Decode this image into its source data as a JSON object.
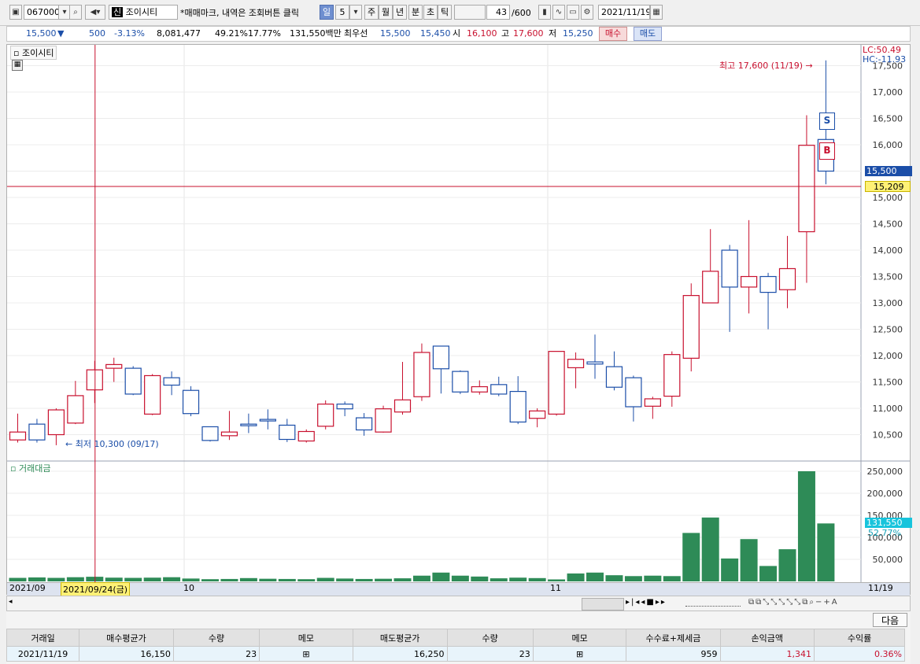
{
  "toolbar": {
    "code": "067000",
    "stock_badge": "신",
    "stock_name": "조이시티",
    "hint": "*매매마크, 내역은 조회버튼 클릭",
    "period_tabs": [
      "일",
      "5",
      "주",
      "월",
      "년",
      "분",
      "초",
      "틱"
    ],
    "active_tab": "일",
    "count": "43",
    "count_max": "/600",
    "date": "2021/11/19"
  },
  "quote": {
    "price": "15,500",
    "change_arrow": "▼",
    "change": "500",
    "change_pct": "-3.13%",
    "volume": "8,081,477",
    "ratio1": "49.21%",
    "ratio2": "17.77%",
    "amount": "131,550백만",
    "best_label": "최우선",
    "best_ask": "15,500",
    "best_bid": "15,450",
    "open_label": "시",
    "open": "16,100",
    "high_label": "고",
    "high": "17,600",
    "low_label": "저",
    "low": "15,250",
    "buy_button": "매수",
    "sell_button": "매도"
  },
  "chart": {
    "stock_label": "조이시티",
    "volume_label": "거래대금",
    "lc": "LC:50.49",
    "hc": "HC:-11.93",
    "current_price": "15,500",
    "crosshair_price": "15,209",
    "volume_current": "131,550",
    "volume_pct": "52.77%",
    "high_note": "최고 17,600 (11/19)",
    "low_note": "최저 10,300 (09/17)",
    "crosshair_date": "2021/09/24(금)",
    "x_labels": [
      "2021/09",
      "10",
      "11",
      "11/19"
    ],
    "sell_marker": "S",
    "buy_marker": "B",
    "colors": {
      "up": "#c8102e",
      "down": "#1b4ea8",
      "volume": "#2e8b57"
    }
  },
  "chart_data": {
    "type": "candlestick",
    "price_axis": {
      "ticks": [
        "17,500",
        "17,000",
        "16,500",
        "16,000",
        "15,500",
        "15,000",
        "14,500",
        "14,000",
        "13,500",
        "13,000",
        "12,500",
        "12,000",
        "11,500",
        "11,000",
        "10,500"
      ],
      "range": [
        10000,
        17700
      ]
    },
    "volume_axis": {
      "ticks": [
        "250,000",
        "200,000",
        "150,000",
        "100,000",
        "50,000"
      ],
      "range": [
        0,
        260000
      ]
    },
    "candles": [
      {
        "o": 10400,
        "c": 10550,
        "h": 10900,
        "l": 10350
      },
      {
        "o": 10700,
        "c": 10400,
        "h": 10800,
        "l": 10350
      },
      {
        "o": 10500,
        "c": 10970,
        "h": 11000,
        "l": 10300
      },
      {
        "o": 10720,
        "c": 11240,
        "h": 11520,
        "l": 10700
      },
      {
        "o": 11350,
        "c": 11730,
        "h": 11900,
        "l": 11100
      },
      {
        "o": 11760,
        "c": 11830,
        "h": 11960,
        "l": 11500
      },
      {
        "o": 11760,
        "c": 11270,
        "h": 11800,
        "l": 11250
      },
      {
        "o": 10890,
        "c": 11620,
        "h": 11650,
        "l": 10870
      },
      {
        "o": 11580,
        "c": 11440,
        "h": 11700,
        "l": 11250
      },
      {
        "o": 11340,
        "c": 10900,
        "h": 11420,
        "l": 10850
      },
      {
        "o": 10650,
        "c": 10390,
        "h": 10650,
        "l": 10370
      },
      {
        "o": 10480,
        "c": 10550,
        "h": 10950,
        "l": 10400
      },
      {
        "o": 10700,
        "c": 10670,
        "h": 10900,
        "l": 10530
      },
      {
        "o": 10790,
        "c": 10760,
        "h": 10980,
        "l": 10600
      },
      {
        "o": 10680,
        "c": 10410,
        "h": 10800,
        "l": 10360
      },
      {
        "o": 10380,
        "c": 10560,
        "h": 10600,
        "l": 10350
      },
      {
        "o": 10660,
        "c": 11080,
        "h": 11150,
        "l": 10600
      },
      {
        "o": 11080,
        "c": 10990,
        "h": 11130,
        "l": 10850
      },
      {
        "o": 10820,
        "c": 10590,
        "h": 10910,
        "l": 10480
      },
      {
        "o": 10550,
        "c": 10990,
        "h": 11050,
        "l": 10540
      },
      {
        "o": 10930,
        "c": 11160,
        "h": 11880,
        "l": 10880
      },
      {
        "o": 11220,
        "c": 12060,
        "h": 12230,
        "l": 11140
      },
      {
        "o": 12180,
        "c": 11750,
        "h": 12180,
        "l": 11280
      },
      {
        "o": 11700,
        "c": 11310,
        "h": 11720,
        "l": 11270
      },
      {
        "o": 11310,
        "c": 11410,
        "h": 11530,
        "l": 11260
      },
      {
        "o": 11450,
        "c": 11270,
        "h": 11600,
        "l": 11230
      },
      {
        "o": 11320,
        "c": 10740,
        "h": 11610,
        "l": 10700
      },
      {
        "o": 10810,
        "c": 10950,
        "h": 11000,
        "l": 10640
      },
      {
        "o": 10890,
        "c": 12080,
        "h": 12080,
        "l": 10860
      },
      {
        "o": 11770,
        "c": 11930,
        "h": 12060,
        "l": 11380
      },
      {
        "o": 11880,
        "c": 11840,
        "h": 12400,
        "l": 11560
      },
      {
        "o": 11790,
        "c": 11400,
        "h": 12080,
        "l": 11340
      },
      {
        "o": 11580,
        "c": 11030,
        "h": 11620,
        "l": 10750
      },
      {
        "o": 11040,
        "c": 11180,
        "h": 11220,
        "l": 10800
      },
      {
        "o": 11230,
        "c": 12020,
        "h": 12080,
        "l": 11030
      },
      {
        "o": 11950,
        "c": 13140,
        "h": 13370,
        "l": 11700
      },
      {
        "o": 13000,
        "c": 13600,
        "h": 14400,
        "l": 13000
      },
      {
        "o": 14000,
        "c": 13300,
        "h": 14100,
        "l": 12450
      },
      {
        "o": 13300,
        "c": 13500,
        "h": 14570,
        "l": 12800
      },
      {
        "o": 13500,
        "c": 13200,
        "h": 13570,
        "l": 12500
      },
      {
        "o": 13250,
        "c": 13650,
        "h": 14270,
        "l": 12900
      },
      {
        "o": 14350,
        "c": 15990,
        "h": 16560,
        "l": 13380
      },
      {
        "o": 16100,
        "c": 15500,
        "h": 17600,
        "l": 15250
      }
    ],
    "volume": [
      8000,
      9000,
      8000,
      9500,
      10500,
      8500,
      8000,
      8500,
      9500,
      6500,
      5000,
      5500,
      7500,
      6000,
      5500,
      5000,
      8000,
      6500,
      5500,
      6000,
      7000,
      13000,
      20000,
      13000,
      11000,
      7000,
      8500,
      7500,
      4500,
      18000,
      20000,
      14000,
      12000,
      13000,
      12000,
      110000,
      145000,
      52000,
      96000,
      35000,
      73000,
      250000,
      131550
    ],
    "high_note_value": 17600,
    "low_note_value": 10300,
    "crosshair_value": 15209
  },
  "trade_table": {
    "next_button": "다음",
    "headers": [
      "거래일",
      "매수평균가",
      "수량",
      "메모",
      "매도평균가",
      "수량",
      "메모",
      "수수료+제세금",
      "손익금액",
      "수익률"
    ],
    "row": [
      "2021/11/19",
      "16,150",
      "23",
      "",
      "16,250",
      "23",
      "",
      "959",
      "1,341",
      "0.36%"
    ]
  }
}
